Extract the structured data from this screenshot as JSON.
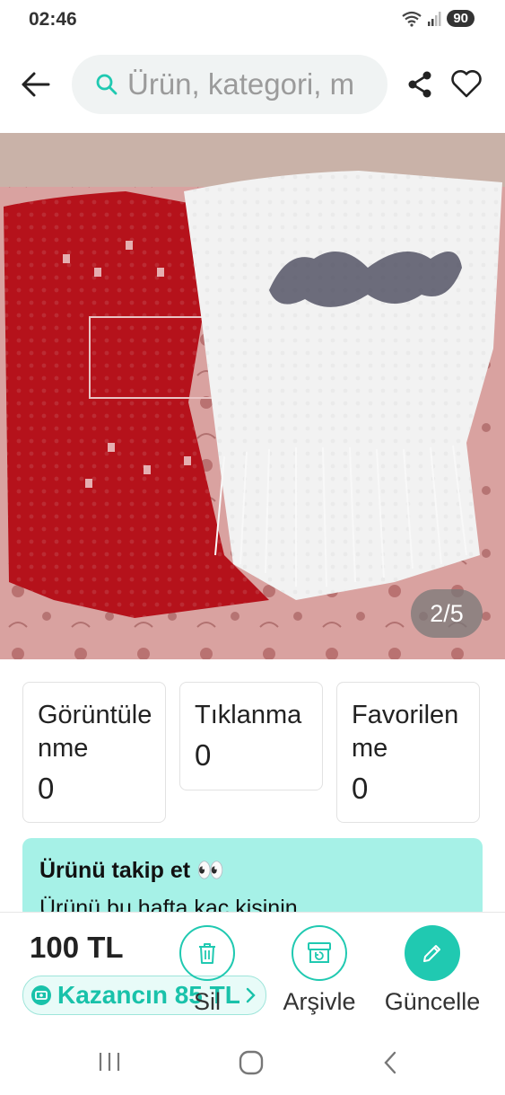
{
  "status": {
    "time": "02:46",
    "battery": "90"
  },
  "search": {
    "placeholder": "Ürün, kategori, m"
  },
  "photo": {
    "counter": "2/5"
  },
  "stats": [
    {
      "label": "Görüntülenme",
      "value": "0"
    },
    {
      "label": "Tıklanma",
      "value": "0"
    },
    {
      "label": "Favorilenme",
      "value": "0"
    }
  ],
  "follow": {
    "title": "Ürünü takip et 👀",
    "text": "Ürünü bu hafta kaç kişinin"
  },
  "bottom": {
    "price": "100 TL",
    "earnings": "Kazancın 85 TL",
    "actions": {
      "delete": "Sil",
      "archive": "Arşivle",
      "update": "Güncelle"
    }
  },
  "colors": {
    "accent": "#20c9b1",
    "follow_bg": "#a6f1e7"
  }
}
